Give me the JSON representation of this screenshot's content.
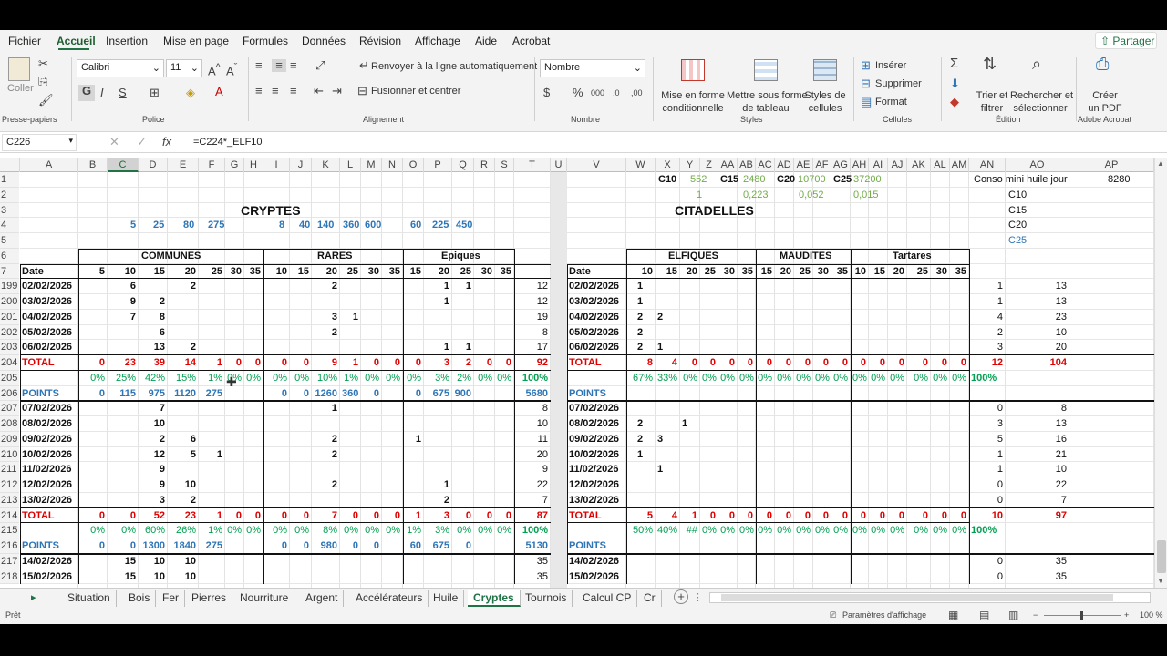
{
  "menu": [
    "Fichier",
    "Accueil",
    "Insertion",
    "Mise en page",
    "Formules",
    "Données",
    "Révision",
    "Affichage",
    "Aide",
    "Acrobat"
  ],
  "share_label": "Partager",
  "ribbon": {
    "paste": "Coller",
    "font_name": "Calibri",
    "font_size": "11",
    "wrap": "Renvoyer à la ligne automatiquement",
    "merge": "Fusionner et centrer",
    "number_format": "Nombre",
    "cond_format": "Mise en forme",
    "cond_format2": "conditionnelle",
    "table_format": "Mettre sous forme",
    "table_format2": "de tableau",
    "cell_styles": "Styles de",
    "cell_styles2": "cellules",
    "insert": "Insérer",
    "delete": "Supprimer",
    "format": "Format",
    "sort": "Trier et",
    "sort2": "filtrer",
    "find": "Rechercher et",
    "find2": "sélectionner",
    "pdf": "Créer",
    "pdf2": "un PDF",
    "groups": [
      "Presse-papiers",
      "Police",
      "Alignement",
      "Nombre",
      "Styles",
      "Cellules",
      "Édition",
      "Adobe Acrobat"
    ],
    "bold": "G",
    "italic": "I",
    "underline": "S"
  },
  "formula_bar": {
    "name_box": "C226",
    "formula": "=C224*_ELF10",
    "fx": "fx"
  },
  "columns": [
    "A",
    "B",
    "C",
    "D",
    "E",
    "F",
    "G",
    "H",
    "I",
    "J",
    "K",
    "L",
    "M",
    "N",
    "O",
    "P",
    "Q",
    "R",
    "S",
    "T",
    "U",
    "V",
    "W",
    "X",
    "Y",
    "Z",
    "AA",
    "AB",
    "AC",
    "AD",
    "AE",
    "AF",
    "AG",
    "AH",
    "AI",
    "AJ",
    "AK",
    "AL",
    "AM",
    "AN",
    "AO",
    "AP"
  ],
  "rows": [
    "1",
    "2",
    "3",
    "4",
    "5",
    "6",
    "7",
    "199",
    "200",
    "201",
    "202",
    "203",
    "204",
    "205",
    "206",
    "207",
    "208",
    "209",
    "210",
    "211",
    "212",
    "213",
    "214",
    "215",
    "216",
    "217",
    "218"
  ],
  "top": {
    "c10": "C10",
    "v552": "552",
    "c15": "C15",
    "v2480": "2480",
    "c20": "C20",
    "v10700": "10700",
    "c25": "C25",
    "v37200": "37200",
    "one": "1",
    "v0223": "0,223",
    "v0052": "0,052",
    "v0015": "0,015",
    "conso": "Conso mini huile jour",
    "conso_val": "8280",
    "an_c10": "C10",
    "an_c15": "C15",
    "an_c20": "C20",
    "an_c25": "C25",
    "cryptes": "CRYPTES",
    "citadelles": "CITADELLES",
    "cost_row": [
      "5",
      "25",
      "80",
      "275",
      "8",
      "40",
      "140",
      "360",
      "600",
      "60",
      "225",
      "450"
    ],
    "communes": "COMMUNES",
    "rares": "RARES",
    "epiques": "Epiques",
    "elfiques": "ELFIQUES",
    "maudites": "MAUDITES",
    "tartares": "Tartares",
    "date": "Date",
    "left_hdr": [
      "5",
      "10",
      "15",
      "20",
      "25",
      "30",
      "35",
      "10",
      "15",
      "20",
      "25",
      "30",
      "35",
      "15",
      "20",
      "25",
      "30",
      "35"
    ],
    "right_hdr": [
      "10",
      "15",
      "20",
      "25",
      "30",
      "35",
      "15",
      "20",
      "25",
      "30",
      "35",
      "10",
      "15",
      "20",
      "25",
      "30",
      "35"
    ]
  },
  "data_rows": [
    {
      "date": "02/02/2026",
      "C": "6",
      "E": "2",
      "K": "2",
      "P": "1",
      "Q": "1",
      "T": "12",
      "rdate": "02/02/2026",
      "W": "1",
      "AN": "1",
      "AO": "13"
    },
    {
      "date": "03/02/2026",
      "C": "9",
      "D": "2",
      "P": "1",
      "T": "12",
      "rdate": "03/02/2026",
      "W": "1",
      "AN": "1",
      "AO": "13"
    },
    {
      "date": "04/02/2026",
      "C": "7",
      "D": "8",
      "K": "3",
      "L": "1",
      "T": "19",
      "rdate": "04/02/2026",
      "W": "2",
      "X": "2",
      "AN": "4",
      "AO": "23"
    },
    {
      "date": "05/02/2026",
      "D": "6",
      "K": "2",
      "T": "8",
      "rdate": "05/02/2026",
      "W": "2",
      "AN": "2",
      "AO": "10"
    },
    {
      "date": "06/02/2026",
      "D": "13",
      "E": "2",
      "P": "1",
      "Q": "1",
      "T": "17",
      "rdate": "06/02/2026",
      "W": "2",
      "X": "1",
      "AN": "3",
      "AO": "20"
    }
  ],
  "total1": {
    "label": "TOTAL",
    "left": [
      "0",
      "23",
      "39",
      "14",
      "1",
      "0",
      "0",
      "0",
      "0",
      "9",
      "1",
      "0",
      "0",
      "0",
      "3",
      "2",
      "0",
      "0"
    ],
    "T": "92",
    "rlabel": "TOTAL",
    "right": [
      "8",
      "4",
      "0",
      "0",
      "0",
      "0",
      "0",
      "0",
      "0",
      "0",
      "0",
      "0",
      "0",
      "0",
      "0",
      "0",
      "0"
    ],
    "AN": "12",
    "AO": "104"
  },
  "pct1": {
    "left": [
      "0%",
      "25%",
      "42%",
      "15%",
      "1%",
      "0%",
      "0%",
      "0%",
      "0%",
      "10%",
      "1%",
      "0%",
      "0%",
      "0%",
      "3%",
      "2%",
      "0%",
      "0%"
    ],
    "T": "100%",
    "right": [
      "67%",
      "33%",
      "0%",
      "0%",
      "0%",
      "0%",
      "0%",
      "0%",
      "0%",
      "0%",
      "0%",
      "0%",
      "0%",
      "0%",
      "0%",
      "0%",
      "0%"
    ],
    "AN": "100%"
  },
  "points1": {
    "label": "POINTS",
    "left": [
      "0",
      "115",
      "975",
      "1120",
      "275",
      "0",
      "0",
      "1260",
      "360",
      "0",
      "0",
      "675",
      "900"
    ],
    "T": "5680",
    "rlabel": "POINTS"
  },
  "data_rows2": [
    {
      "date": "07/02/2026",
      "D": "7",
      "K": "1",
      "T": "8",
      "rdate": "07/02/2026",
      "AN": "0",
      "AO": "8"
    },
    {
      "date": "08/02/2026",
      "D": "10",
      "T": "10",
      "rdate": "08/02/2026",
      "W": "2",
      "Y": "1",
      "AN": "3",
      "AO": "13"
    },
    {
      "date": "09/02/2026",
      "D": "2",
      "E": "6",
      "K": "2",
      "O": "1",
      "T": "11",
      "rdate": "09/02/2026",
      "W": "2",
      "X": "3",
      "AN": "5",
      "AO": "16"
    },
    {
      "date": "10/02/2026",
      "D": "12",
      "E": "5",
      "F": "1",
      "K": "2",
      "T": "20",
      "rdate": "10/02/2026",
      "W": "1",
      "AN": "1",
      "AO": "21"
    },
    {
      "date": "11/02/2026",
      "D": "9",
      "T": "9",
      "rdate": "11/02/2026",
      "X": "1",
      "AN": "1",
      "AO": "10"
    },
    {
      "date": "12/02/2026",
      "D": "9",
      "E": "10",
      "K": "2",
      "P": "1",
      "T": "22",
      "rdate": "12/02/2026",
      "AN": "0",
      "AO": "22"
    },
    {
      "date": "13/02/2026",
      "D": "3",
      "E": "2",
      "P": "2",
      "T": "7",
      "rdate": "13/02/2026",
      "AN": "0",
      "AO": "7"
    }
  ],
  "total2": {
    "label": "TOTAL",
    "left": [
      "0",
      "0",
      "52",
      "23",
      "1",
      "0",
      "0",
      "0",
      "0",
      "7",
      "0",
      "0",
      "0",
      "1",
      "3",
      "0",
      "0",
      "0"
    ],
    "T": "87",
    "rlabel": "TOTAL",
    "right": [
      "5",
      "4",
      "1",
      "0",
      "0",
      "0",
      "0",
      "0",
      "0",
      "0",
      "0",
      "0",
      "0",
      "0",
      "0",
      "0",
      "0"
    ],
    "AN": "10",
    "AO": "97"
  },
  "pct2": {
    "left": [
      "0%",
      "0%",
      "60%",
      "26%",
      "1%",
      "0%",
      "0%",
      "0%",
      "0%",
      "8%",
      "0%",
      "0%",
      "0%",
      "1%",
      "3%",
      "0%",
      "0%",
      "0%"
    ],
    "T": "100%",
    "right": [
      "50%",
      "40%",
      "##",
      "0%",
      "0%",
      "0%",
      "0%",
      "0%",
      "0%",
      "0%",
      "0%",
      "0%",
      "0%",
      "0%",
      "0%",
      "0%",
      "0%"
    ],
    "AN": "100%"
  },
  "points2": {
    "label": "POINTS",
    "left": [
      "0",
      "0",
      "1300",
      "1840",
      "275",
      "0",
      "0",
      "980",
      "0",
      "0",
      "60",
      "675",
      "0"
    ],
    "T": "5130",
    "rlabel": "POINTS"
  },
  "data_rows3": [
    {
      "date": "14/02/2026",
      "C": "15",
      "D": "10",
      "E": "10",
      "T": "35",
      "rdate": "14/02/2026",
      "AN": "0",
      "AO": "35"
    },
    {
      "date": "15/02/2026",
      "C": "15",
      "D": "10",
      "E": "10",
      "T": "35",
      "rdate": "15/02/2026",
      "AN": "0",
      "AO": "35"
    }
  ],
  "tabs": [
    "Situation",
    "Bois",
    "Fer",
    "Pierres",
    "Nourriture",
    "Argent",
    "Accélérateurs",
    "Huile",
    "Cryptes",
    "Tournois",
    "Calcul CP",
    "Cr"
  ],
  "active_tab": "Cryptes",
  "status": {
    "ready": "Prêt",
    "display": "Paramètres d'affichage",
    "zoom": "100 %"
  }
}
